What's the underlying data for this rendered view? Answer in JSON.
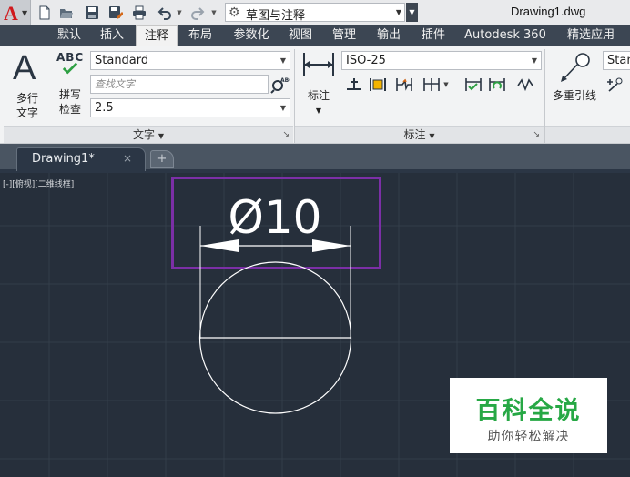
{
  "title_bar": {
    "app_letter": "A",
    "workspace": "草图与注释",
    "document_title": "Drawing1.dwg"
  },
  "quick_access": [
    "new-icon",
    "open-icon",
    "save-icon",
    "save-as-icon",
    "print-icon",
    "undo-icon",
    "redo-icon"
  ],
  "tabs": [
    "默认",
    "插入",
    "注释",
    "布局",
    "参数化",
    "视图",
    "管理",
    "输出",
    "插件",
    "Autodesk 360",
    "精选应用"
  ],
  "active_tab": "注释",
  "text_panel": {
    "multiline_label_1": "多行",
    "multiline_label_2": "文字",
    "spell_icon_text": "ABC",
    "spell_label_1": "拼写",
    "spell_label_2": "检查",
    "style_value": "Standard",
    "find_placeholder": "查找文字",
    "height_value": "2.5",
    "title": "文字"
  },
  "dim_panel": {
    "dim_label": "标注",
    "dimstyle_value": "ISO-25",
    "title": "标注"
  },
  "leader_panel": {
    "label": "多重引线",
    "style_value": "Stan"
  },
  "doc_tab": {
    "name": "Drawing1*",
    "close": "×"
  },
  "viewport_label": "[-][俯视][二维线框]",
  "drawing": {
    "dimension_text": "Ø10",
    "highlight_color": "#7b2fa6",
    "line_color": "#ffffff"
  },
  "watermark": {
    "line1": "百科全说",
    "line2": "助你轻松解决",
    "color": "#27a845"
  }
}
